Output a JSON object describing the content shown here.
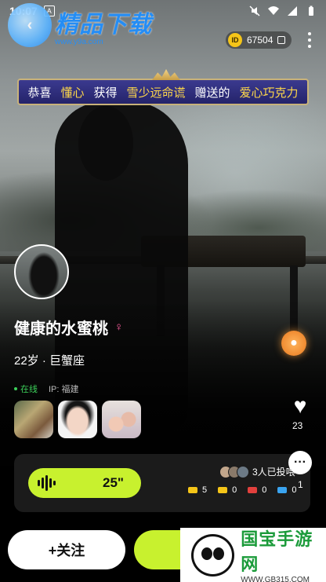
{
  "status_bar": {
    "time": "10:07"
  },
  "watermark_top": {
    "title": "精品下载",
    "url": "www.y9a.com"
  },
  "header": {
    "id_label": "ID",
    "id_value": "67504"
  },
  "banner": {
    "parts": [
      "恭喜",
      "懂心",
      "获得",
      "雪少远命谎",
      "赠送的",
      "爱心巧克力"
    ]
  },
  "profile": {
    "name": "健康的水蜜桃",
    "age_sign": "22岁 · 巨蟹座",
    "online": "在线",
    "ip": "IP: 福建"
  },
  "likes": {
    "count": "23"
  },
  "voice": {
    "duration": "25\"",
    "voted_text": "3人已投喂"
  },
  "gifts": [
    {
      "icon": "bone-icon",
      "count": "5",
      "color": "#f5c518"
    },
    {
      "icon": "car-icon",
      "count": "0",
      "color": "#f5c518"
    },
    {
      "icon": "lock-icon",
      "count": "0",
      "color": "#e2403d"
    },
    {
      "icon": "fish-icon",
      "count": "0",
      "color": "#3aa4f0"
    }
  ],
  "chat": {
    "count": "1"
  },
  "actions": {
    "follow_label": "+关注"
  },
  "watermark_bottom": {
    "title": "国宝手游网",
    "url": "WWW.GB315.COM"
  },
  "colors": {
    "accent": "#c8f12e",
    "gold": "#ffd84a",
    "online": "#3cd05a"
  }
}
